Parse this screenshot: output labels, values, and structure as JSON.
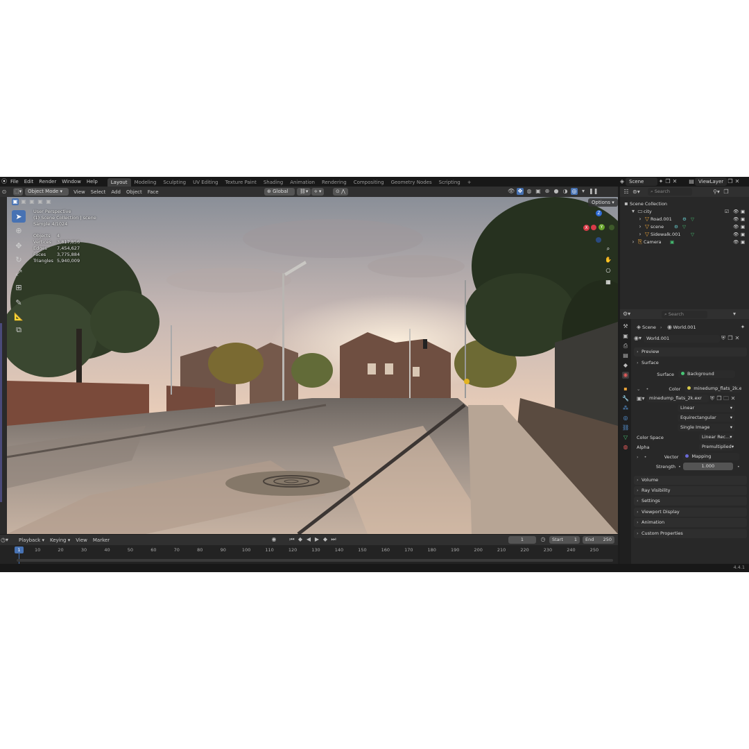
{
  "topbar": {
    "menu": [
      "File",
      "Edit",
      "Render",
      "Window",
      "Help"
    ],
    "workspaces": [
      "Layout",
      "Modeling",
      "Sculpting",
      "UV Editing",
      "Texture Paint",
      "Shading",
      "Animation",
      "Rendering",
      "Compositing",
      "Geometry Nodes",
      "Scripting"
    ],
    "active_workspace": "Layout",
    "add_tab": "+",
    "scene": "Scene",
    "view_layer": "ViewLayer"
  },
  "viewport_header": {
    "mode": "Object Mode",
    "menu": [
      "View",
      "Select",
      "Add",
      "Object",
      "Face"
    ],
    "transform_orientation": "Global",
    "options": "Options"
  },
  "viewport": {
    "view_name": "User Perspective",
    "collection": "(1) Scene Collection | scene",
    "sample": "Sample 4/1024",
    "stats": [
      {
        "label": "Objects",
        "value": "4"
      },
      {
        "label": "Vertices",
        "value": "3,817,856"
      },
      {
        "label": "Edges",
        "value": "7,454,627"
      },
      {
        "label": "Faces",
        "value": "3,775,884"
      },
      {
        "label": "Triangles",
        "value": "5,940,009"
      }
    ],
    "gizmo": {
      "x": "X",
      "y": "Y",
      "z": "Z"
    }
  },
  "outliner": {
    "search_placeholder": "Search",
    "root": "Scene Collection",
    "collection": "city",
    "items": [
      "Road.001",
      "scene",
      "Sidewalk.001"
    ],
    "camera": "Camera"
  },
  "properties": {
    "search_placeholder": "Search",
    "breadcrumb": [
      "Scene",
      "World.001"
    ],
    "world_name": "World.001",
    "panels_top": [
      "Preview",
      "Surface"
    ],
    "surface": {
      "surface_label": "Surface",
      "surface_value": "Background",
      "color_label": "Color",
      "color_value": "minedump_flats_2k.exr",
      "image_name": "minedump_flats_2k.exr",
      "interpolation": "Linear",
      "projection": "Equirectangular",
      "source": "Single Image",
      "color_space_label": "Color Space",
      "color_space_value": "Linear Rec...",
      "alpha_label": "Alpha",
      "alpha_value": "Premultiplied",
      "vector_label": "Vector",
      "vector_value": "Mapping",
      "strength_label": "Strength",
      "strength_value": "1.000"
    },
    "panels_bottom": [
      "Volume",
      "Ray Visibility",
      "Settings",
      "Viewport Display",
      "Animation",
      "Custom Properties"
    ]
  },
  "timeline": {
    "menu": [
      "Playback",
      "Keying",
      "View",
      "Marker"
    ],
    "current_frame": "1",
    "start_label": "Start",
    "start_value": "1",
    "end_label": "End",
    "end_value": "250",
    "ticks": [
      "10",
      "20",
      "30",
      "40",
      "50",
      "60",
      "70",
      "80",
      "90",
      "100",
      "110",
      "120",
      "130",
      "140",
      "150",
      "160",
      "170",
      "180",
      "190",
      "200",
      "210",
      "220",
      "230",
      "240",
      "250"
    ],
    "playhead": "1"
  },
  "statusbar": {
    "version": "4.4.1"
  }
}
